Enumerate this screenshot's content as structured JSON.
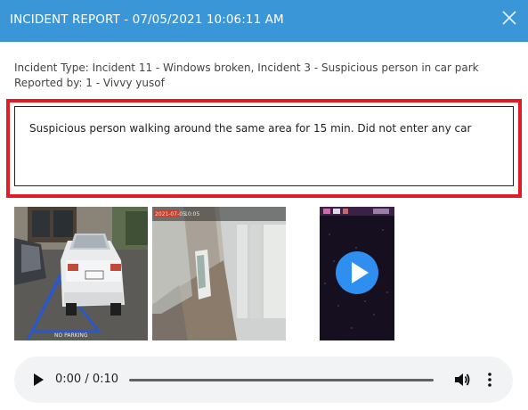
{
  "header": {
    "title": "INCIDENT REPORT - 07/05/2021 10:06:11 AM",
    "close_icon": "close-icon",
    "background": "#3a96d6"
  },
  "incident": {
    "type_line": "Incident Type: Incident 11 - Windows broken, Incident 3 - Suspicious person in car park",
    "reported_by_line": "Reported by: 1 - Vivvy yusof",
    "description": "Suspicious person walking around the same area for 15 min. Did not enter any car"
  },
  "highlight_color": "#e51b24",
  "media": {
    "images": [
      {
        "kind": "photo",
        "subject": "white car parked in accessible parking space"
      },
      {
        "kind": "photo",
        "subject": "cctv view of corridor beside building"
      }
    ],
    "video": {
      "kind": "video",
      "play_icon": "play-circle-icon"
    }
  },
  "audio": {
    "time": "0:00 / 0:10",
    "progress": 0.0,
    "play_icon": "play-icon",
    "volume_icon": "volume-icon",
    "menu_icon": "more-vert-icon"
  }
}
